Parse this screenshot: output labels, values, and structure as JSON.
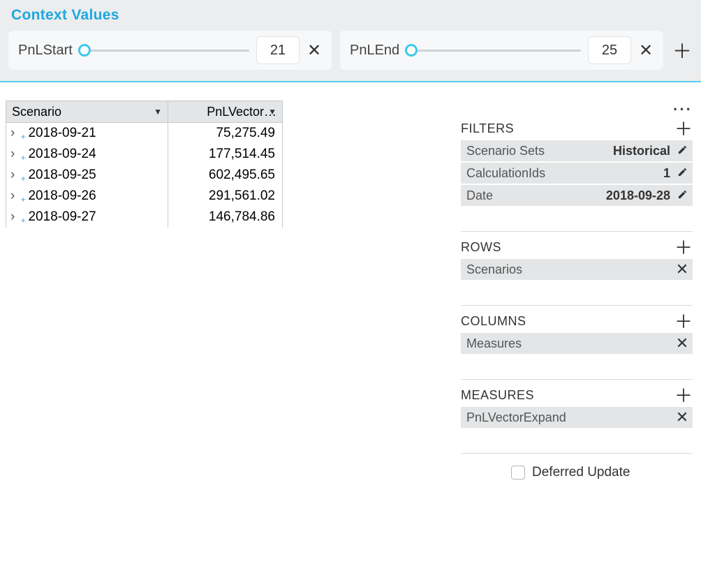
{
  "context": {
    "title": "Context Values",
    "items": [
      {
        "label": "PnLStart",
        "value": "21"
      },
      {
        "label": "PnLEnd",
        "value": "25"
      }
    ]
  },
  "table": {
    "columns": [
      "Scenario",
      "PnLVector…"
    ],
    "rows": [
      {
        "label": "2018-09-21",
        "value": "75,275.49"
      },
      {
        "label": "2018-09-24",
        "value": "177,514.45"
      },
      {
        "label": "2018-09-25",
        "value": "602,495.65"
      },
      {
        "label": "2018-09-26",
        "value": "291,561.02"
      },
      {
        "label": "2018-09-27",
        "value": "146,784.86"
      }
    ]
  },
  "panel": {
    "filters": {
      "title": "FILTERS",
      "items": [
        {
          "k": "Scenario Sets",
          "v": "Historical"
        },
        {
          "k": "CalculationIds",
          "v": "1"
        },
        {
          "k": "Date",
          "v": "2018-09-28"
        }
      ]
    },
    "rows": {
      "title": "ROWS",
      "items": [
        "Scenarios"
      ]
    },
    "columns": {
      "title": "COLUMNS",
      "items": [
        "Measures"
      ]
    },
    "measures": {
      "title": "MEASURES",
      "items": [
        "PnLVectorExpand"
      ]
    },
    "deferred_label": "Deferred Update",
    "deferred_checked": false
  }
}
